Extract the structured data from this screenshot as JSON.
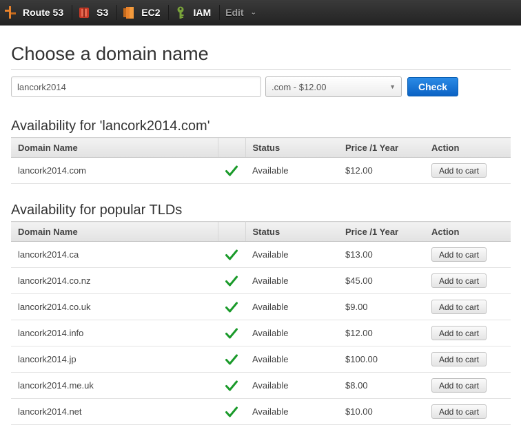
{
  "topnav": {
    "items": [
      {
        "label": "Route 53",
        "icon": "route53-icon",
        "color": "#e8822b"
      },
      {
        "label": "S3",
        "icon": "s3-icon",
        "color": "#d9442b"
      },
      {
        "label": "EC2",
        "icon": "ec2-icon",
        "color": "#e8822b"
      },
      {
        "label": "IAM",
        "icon": "iam-key-icon",
        "color": "#7aa43a"
      }
    ],
    "edit_label": "Edit"
  },
  "page": {
    "title": "Choose a domain name"
  },
  "search": {
    "domain_value": "lancork2014",
    "tld_selected": ".com - $12.00",
    "check_label": "Check"
  },
  "columns": {
    "domain": "Domain Name",
    "status": "Status",
    "price": "Price /1 Year",
    "action": "Action"
  },
  "primary": {
    "title": "Availability for 'lancork2014.com'",
    "rows": [
      {
        "domain": "lancork2014.com",
        "status": "Available",
        "price": "$12.00",
        "action": "Add to cart"
      }
    ]
  },
  "popular": {
    "title": "Availability for popular TLDs",
    "rows": [
      {
        "domain": "lancork2014.ca",
        "status": "Available",
        "price": "$13.00",
        "action": "Add to cart"
      },
      {
        "domain": "lancork2014.co.nz",
        "status": "Available",
        "price": "$45.00",
        "action": "Add to cart"
      },
      {
        "domain": "lancork2014.co.uk",
        "status": "Available",
        "price": "$9.00",
        "action": "Add to cart"
      },
      {
        "domain": "lancork2014.info",
        "status": "Available",
        "price": "$12.00",
        "action": "Add to cart"
      },
      {
        "domain": "lancork2014.jp",
        "status": "Available",
        "price": "$100.00",
        "action": "Add to cart"
      },
      {
        "domain": "lancork2014.me.uk",
        "status": "Available",
        "price": "$8.00",
        "action": "Add to cart"
      },
      {
        "domain": "lancork2014.net",
        "status": "Available",
        "price": "$10.00",
        "action": "Add to cart"
      }
    ]
  },
  "colors": {
    "available_check": "#1a9a2a",
    "primary_button": "#0b62c4"
  }
}
